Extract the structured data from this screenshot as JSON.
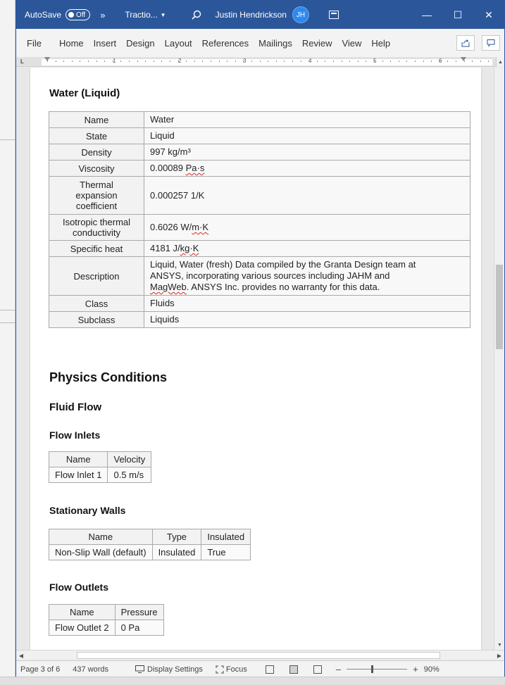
{
  "titlebar": {
    "autosave_label": "AutoSave",
    "autosave_state": "Off",
    "more": "»",
    "doc_title": "Tractio...",
    "user_name": "Justin Hendrickson",
    "user_initials": "JH",
    "minimize": "—",
    "maximize": "☐",
    "close": "✕"
  },
  "menu": {
    "tabs": [
      "File",
      "Home",
      "Insert",
      "Design",
      "Layout",
      "References",
      "Mailings",
      "Review",
      "View",
      "Help"
    ]
  },
  "ruler": {
    "L": "L",
    "numbers": [
      "1",
      "2",
      "3",
      "4",
      "5",
      "6"
    ]
  },
  "material": {
    "heading": "Water (Liquid)",
    "rows": [
      {
        "k": "Name",
        "v": "Water"
      },
      {
        "k": "State",
        "v": "Liquid"
      },
      {
        "k": "Density",
        "v": "997 kg/m³"
      },
      {
        "k": "Viscosity",
        "v_pre": "0.00089 ",
        "v_sq": "Pa·s"
      },
      {
        "k": "Thermal expansion coefficient",
        "v": "0.000257 1/K"
      },
      {
        "k": "Isotropic thermal conductivity",
        "v_pre": "0.6026 W/",
        "v_sq": "m·K"
      },
      {
        "k": "Specific heat",
        "v_pre": "4181 J/",
        "v_sq": "kg·K"
      },
      {
        "k": "Description",
        "v_line1": "Liquid, Water (fresh) Data compiled by the Granta Design team at",
        "v_line2": "ANSYS, incorporating various sources including JAHM and",
        "v_sq": "MagWeb",
        "v_line3": ". ANSYS Inc. provides no warranty for this data."
      },
      {
        "k": "Class",
        "v": "Fluids"
      },
      {
        "k": "Subclass",
        "v": "Liquids"
      }
    ]
  },
  "physics": {
    "heading": "Physics Conditions",
    "fluid_flow": "Fluid Flow",
    "inlets": {
      "heading": "Flow Inlets",
      "cols": [
        "Name",
        "Velocity"
      ],
      "row": [
        "Flow Inlet 1",
        "0.5 m/s"
      ]
    },
    "walls": {
      "heading": "Stationary Walls",
      "cols": [
        "Name",
        "Type",
        "Insulated"
      ],
      "row": [
        "Non-Slip Wall (default)",
        "Insulated",
        "True"
      ]
    },
    "outlets": {
      "heading": "Flow Outlets",
      "cols": [
        "Name",
        "Pressure"
      ],
      "row": [
        "Flow Outlet 2",
        "0 Pa"
      ]
    }
  },
  "status": {
    "page": "Page 3 of 6",
    "words": "437 words",
    "display_settings": "Display Settings",
    "focus": "Focus",
    "zoom_minus": "–",
    "zoom_plus": "+",
    "zoom": "90%",
    "zoom_fraction": 0.42
  },
  "colors": {
    "accent": "#2b579a",
    "avatar": "#2d89ef"
  }
}
